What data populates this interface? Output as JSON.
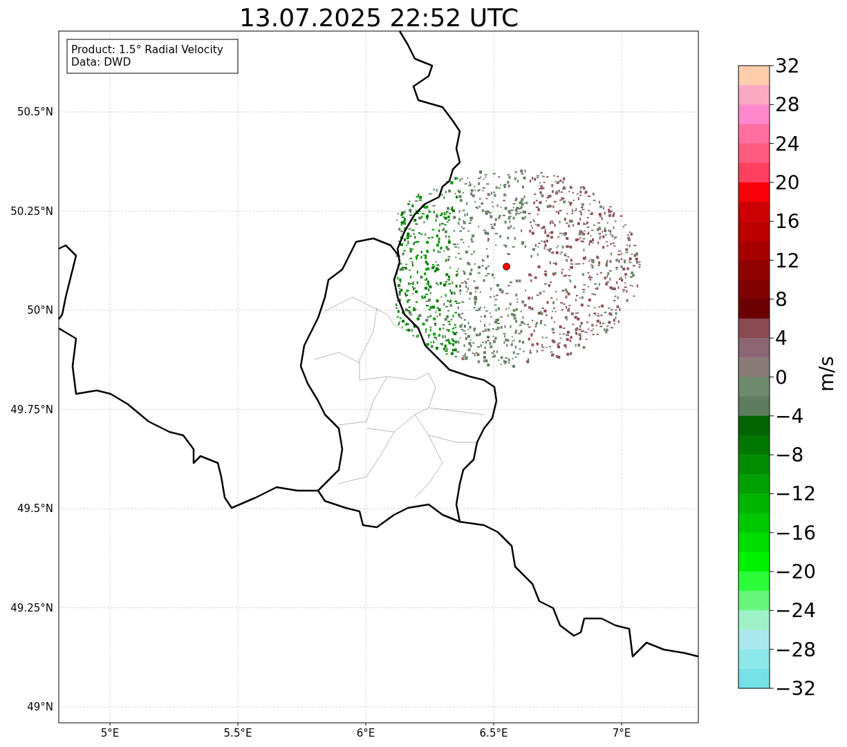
{
  "title": "13.07.2025 22:52 UTC",
  "info_box": {
    "lines": [
      "Product: 1.5° Radial Velocity",
      "Data: DWD"
    ]
  },
  "map": {
    "xticks": [
      "5°E",
      "5.5°E",
      "6°E",
      "6.5°E",
      "7°E"
    ],
    "yticks": [
      "50.5°N",
      "50.25°N",
      "50°N",
      "49.75°N",
      "49.5°N",
      "49.25°N",
      "49°N"
    ]
  },
  "colorbar": {
    "label": "m/s",
    "ticks": [
      "32",
      "28",
      "24",
      "20",
      "16",
      "12",
      "8",
      "4",
      "0",
      "−4",
      "−8",
      "−12",
      "−16",
      "−20",
      "−24",
      "−28",
      "−32"
    ],
    "bands": [
      {
        "color": "#ffceac"
      },
      {
        "color": "#ffaac4"
      },
      {
        "color": "#ff88cc"
      },
      {
        "color": "#ff70a0"
      },
      {
        "color": "#ff5a80"
      },
      {
        "color": "#ff4060"
      },
      {
        "color": "#f80008"
      },
      {
        "color": "#cc0000"
      },
      {
        "color": "#bb0000"
      },
      {
        "color": "#a80000"
      },
      {
        "color": "#900000"
      },
      {
        "color": "#7e0000"
      },
      {
        "color": "#6b0000"
      },
      {
        "color": "#8a4a52"
      },
      {
        "color": "#8a6672"
      },
      {
        "color": "#8a7a78"
      },
      {
        "color": "#6e8a6e"
      },
      {
        "color": "#5e7d5e"
      },
      {
        "color": "#006400"
      },
      {
        "color": "#007800"
      },
      {
        "color": "#008c00"
      },
      {
        "color": "#00a000"
      },
      {
        "color": "#00b400"
      },
      {
        "color": "#00c800"
      },
      {
        "color": "#00dc00"
      },
      {
        "color": "#00f200"
      },
      {
        "color": "#2cfd38"
      },
      {
        "color": "#66f77c"
      },
      {
        "color": "#9ff2c8"
      },
      {
        "color": "#aae8ee"
      },
      {
        "color": "#8de8ea"
      },
      {
        "color": "#76e2e6"
      }
    ]
  }
}
